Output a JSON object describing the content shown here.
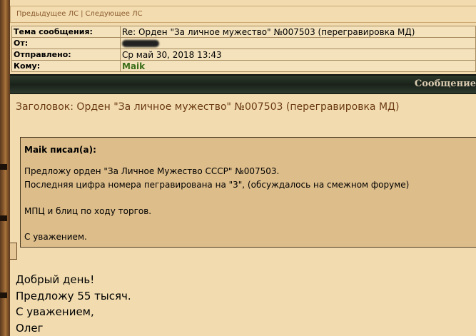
{
  "nav": {
    "prev": "Предыдущее ЛС",
    "separator": "|",
    "next": "Следующее ЛС"
  },
  "headers": {
    "subject_label": "Тема сообщения:",
    "subject_value": "Re: Орден \"За личное мужество\" №007503 (перегравировка МД)",
    "from_label": "От:",
    "sent_label": "Отправлено:",
    "sent_value": "Ср май 30, 2018 13:43",
    "to_label": "Кому:",
    "to_value": "Maik"
  },
  "section_title": "Сообщение",
  "message": {
    "title": "Заголовок: Орден \"За личное мужество\" №007503 (перегравировка МД)",
    "quote": {
      "author": "Maik писал(а):",
      "line1": "Предложу орден \"За Личное Мужество СССР\" №007503.",
      "line2": "Последняя цифра номера пегравирована на \"3\", (обсуждалось на смежном форуме)",
      "line3": "МПЦ и блиц по ходу торгов.",
      "line4": "С уважением."
    },
    "body": {
      "line1": "Добрый день!",
      "line2": "Предложу 55 тысяч.",
      "line3": "С уважением,",
      "line4": "Олег"
    }
  },
  "colors": {
    "page_bg": "#f2dcaf",
    "quote_bg": "#ddbd8a",
    "title_color": "#6b3a14",
    "user_color": "#3a6e1a",
    "link_color": "#8a5a2e"
  }
}
